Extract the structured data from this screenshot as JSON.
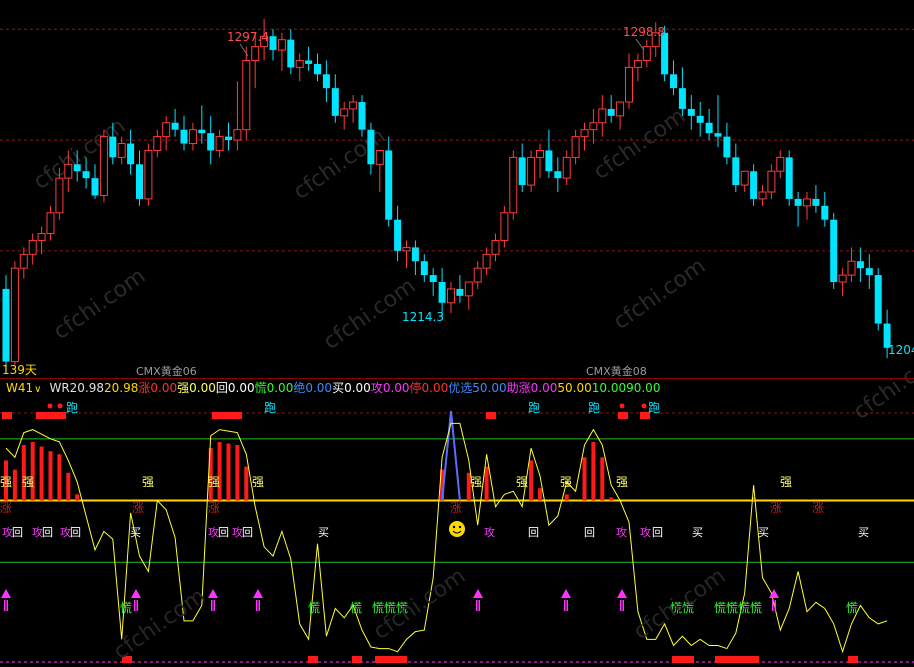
{
  "main_chart": {
    "period_label": "139天",
    "contract_labels": [
      "CMX黄金06",
      "CMX黄金08"
    ],
    "price_annotations": [
      "1297.4",
      "1298.8",
      "1214.3",
      "1204"
    ],
    "watermark": "cfchi.com",
    "colors": {
      "up": "#ff3b3b",
      "down": "#00e5ff",
      "grid": "#8b1a1a",
      "label": "#ff4d4d",
      "low_label": "#00e5ff"
    }
  },
  "indicator": {
    "name": "W41",
    "dropdown_icon": "chevron-down-icon",
    "items": [
      {
        "label": "WR",
        "value": "20.98",
        "label_color": "#e0e0e0",
        "value_color": "#e0e0e0"
      },
      {
        "label": "",
        "value": "20.98",
        "label_color": "#ffd800",
        "value_color": "#ffd800"
      },
      {
        "label": "涨",
        "value": "0.00",
        "label_color": "#ff3030",
        "value_color": "#ff3030"
      },
      {
        "label": "强",
        "value": "0.00",
        "label_color": "#ffff66",
        "value_color": "#ffff66"
      },
      {
        "label": "回",
        "value": "0.00",
        "label_color": "#ffffff",
        "value_color": "#ffffff"
      },
      {
        "label": "慌",
        "value": "0.00",
        "label_color": "#33ff33",
        "value_color": "#33ff33"
      },
      {
        "label": "绝",
        "value": "0.00",
        "label_color": "#3b8bff",
        "value_color": "#3b8bff"
      },
      {
        "label": "买",
        "value": "0.00",
        "label_color": "#ffffff",
        "value_color": "#ffffff"
      },
      {
        "label": "攻",
        "value": "0.00",
        "label_color": "#ff33ff",
        "value_color": "#ff33ff"
      },
      {
        "label": "停",
        "value": "0.00",
        "label_color": "#ff3030",
        "value_color": "#ff3030"
      },
      {
        "label": "优选",
        "value": "50.00",
        "label_color": "#3b8bff",
        "value_color": "#3b8bff"
      },
      {
        "label": "助涨",
        "value": "0.00",
        "label_color": "#ff33ff",
        "value_color": "#ff33ff"
      },
      {
        "label": "",
        "value": "50.00",
        "label_color": "#ffd800",
        "value_color": "#ffd800"
      },
      {
        "label": "",
        "value": "10.00",
        "label_color": "#33ff33",
        "value_color": "#33ff33"
      },
      {
        "label": "",
        "value": "90.00",
        "label_color": "#33ff33",
        "value_color": "#33ff33"
      }
    ],
    "signal_labels": {
      "run": "跑",
      "strong": "强",
      "rise": "涨",
      "buy": "买",
      "panic": "慌",
      "attack": "攻",
      "back": "回"
    },
    "emoji_icon": "smiley-icon"
  },
  "chart_data": [
    {
      "type": "candlestick",
      "title": "",
      "series": [
        {
          "ohlc": [
            [
              1222,
              1226,
              1198,
              1201
            ],
            [
              1201,
              1230,
              1200,
              1228
            ],
            [
              1228,
              1234,
              1225,
              1232
            ],
            [
              1232,
              1238,
              1229,
              1236
            ],
            [
              1236,
              1240,
              1232,
              1238
            ],
            [
              1238,
              1246,
              1236,
              1244
            ],
            [
              1244,
              1257,
              1242,
              1254
            ],
            [
              1254,
              1262,
              1250,
              1258
            ],
            [
              1258,
              1262,
              1253,
              1256
            ],
            [
              1256,
              1260,
              1251,
              1254
            ],
            [
              1254,
              1258,
              1248,
              1249
            ],
            [
              1249,
              1268,
              1247,
              1266
            ],
            [
              1266,
              1270,
              1258,
              1260
            ],
            [
              1260,
              1266,
              1258,
              1264
            ],
            [
              1264,
              1268,
              1255,
              1258
            ],
            [
              1258,
              1262,
              1246,
              1248
            ],
            [
              1248,
              1264,
              1246,
              1262
            ],
            [
              1262,
              1268,
              1260,
              1266
            ],
            [
              1266,
              1272,
              1262,
              1270
            ],
            [
              1270,
              1274,
              1266,
              1268
            ],
            [
              1268,
              1272,
              1262,
              1264
            ],
            [
              1264,
              1270,
              1262,
              1268
            ],
            [
              1268,
              1275,
              1264,
              1267
            ],
            [
              1267,
              1272,
              1258,
              1262
            ],
            [
              1262,
              1268,
              1260,
              1266
            ],
            [
              1266,
              1270,
              1262,
              1265
            ],
            [
              1265,
              1282,
              1262,
              1268
            ],
            [
              1268,
              1292,
              1265,
              1288
            ],
            [
              1288,
              1296,
              1280,
              1292
            ],
            [
              1292,
              1300,
              1288,
              1295
            ],
            [
              1295,
              1297,
              1288,
              1291
            ],
            [
              1291,
              1296,
              1285,
              1294
            ],
            [
              1294,
              1297,
              1284,
              1286
            ],
            [
              1286,
              1290,
              1282,
              1288
            ],
            [
              1288,
              1292,
              1285,
              1287
            ],
            [
              1287,
              1290,
              1282,
              1284
            ],
            [
              1284,
              1288,
              1276,
              1280
            ],
            [
              1280,
              1284,
              1270,
              1272
            ],
            [
              1272,
              1276,
              1268,
              1274
            ],
            [
              1274,
              1278,
              1270,
              1276
            ],
            [
              1276,
              1278,
              1266,
              1268
            ],
            [
              1268,
              1270,
              1255,
              1258
            ],
            [
              1258,
              1262,
              1250,
              1262
            ],
            [
              1262,
              1266,
              1240,
              1242
            ],
            [
              1242,
              1246,
              1230,
              1233
            ],
            [
              1233,
              1236,
              1228,
              1234
            ],
            [
              1234,
              1236,
              1226,
              1230
            ],
            [
              1230,
              1232,
              1224,
              1226
            ],
            [
              1226,
              1228,
              1220,
              1224
            ],
            [
              1224,
              1228,
              1214,
              1218
            ],
            [
              1218,
              1224,
              1215,
              1222
            ],
            [
              1222,
              1226,
              1218,
              1220
            ],
            [
              1220,
              1224,
              1216,
              1224
            ],
            [
              1224,
              1230,
              1222,
              1228
            ],
            [
              1228,
              1234,
              1226,
              1232
            ],
            [
              1232,
              1238,
              1230,
              1236
            ],
            [
              1236,
              1246,
              1234,
              1244
            ],
            [
              1244,
              1262,
              1242,
              1260
            ],
            [
              1260,
              1264,
              1250,
              1252
            ],
            [
              1252,
              1262,
              1250,
              1260
            ],
            [
              1260,
              1264,
              1254,
              1262
            ],
            [
              1262,
              1268,
              1254,
              1256
            ],
            [
              1256,
              1260,
              1250,
              1254
            ],
            [
              1254,
              1262,
              1252,
              1260
            ],
            [
              1260,
              1268,
              1258,
              1266
            ],
            [
              1266,
              1270,
              1262,
              1268
            ],
            [
              1268,
              1274,
              1264,
              1270
            ],
            [
              1270,
              1278,
              1266,
              1274
            ],
            [
              1274,
              1278,
              1270,
              1272
            ],
            [
              1272,
              1276,
              1268,
              1276
            ],
            [
              1276,
              1290,
              1274,
              1286
            ],
            [
              1286,
              1290,
              1282,
              1288
            ],
            [
              1288,
              1294,
              1286,
              1292
            ],
            [
              1292,
              1299,
              1289,
              1296
            ],
            [
              1296,
              1298,
              1282,
              1284
            ],
            [
              1284,
              1288,
              1278,
              1280
            ],
            [
              1280,
              1286,
              1272,
              1274
            ],
            [
              1274,
              1278,
              1268,
              1272
            ],
            [
              1272,
              1276,
              1266,
              1270
            ],
            [
              1270,
              1274,
              1265,
              1267
            ],
            [
              1267,
              1278,
              1263,
              1266
            ],
            [
              1266,
              1270,
              1258,
              1260
            ],
            [
              1260,
              1264,
              1250,
              1252
            ],
            [
              1252,
              1256,
              1250,
              1256
            ],
            [
              1256,
              1258,
              1246,
              1248
            ],
            [
              1248,
              1252,
              1246,
              1250
            ],
            [
              1250,
              1258,
              1248,
              1256
            ],
            [
              1256,
              1262,
              1254,
              1260
            ],
            [
              1260,
              1262,
              1246,
              1248
            ],
            [
              1248,
              1250,
              1240,
              1246
            ],
            [
              1246,
              1250,
              1242,
              1248
            ],
            [
              1248,
              1252,
              1244,
              1246
            ],
            [
              1246,
              1250,
              1240,
              1242
            ],
            [
              1242,
              1244,
              1222,
              1224
            ],
            [
              1224,
              1228,
              1220,
              1226
            ],
            [
              1226,
              1234,
              1224,
              1230
            ],
            [
              1230,
              1234,
              1224,
              1228
            ],
            [
              1228,
              1232,
              1222,
              1226
            ],
            [
              1226,
              1228,
              1210,
              1212
            ],
            [
              1212,
              1216,
              1202,
              1205
            ]
          ]
        }
      ],
      "xlabel": "",
      "ylabel": "",
      "ylim": [
        1198,
        1302
      ]
    },
    {
      "type": "line",
      "title": "",
      "series": [
        {
          "name": "WR",
          "values": [
            84,
            78,
            94,
            96,
            93,
            90,
            88,
            76,
            62,
            40,
            18,
            30,
            25,
            -40,
            42,
            14,
            4,
            50,
            44,
            26,
            -28,
            -28,
            -18,
            92,
            96,
            95,
            94,
            80,
            46,
            20,
            14,
            30,
            12,
            -30,
            -40,
            22,
            -38,
            -20,
            -26,
            -18,
            -34,
            -45,
            -46,
            -46,
            -48,
            -40,
            -35,
            -34,
            0,
            78,
            100,
            100,
            76,
            34,
            80,
            46,
            54,
            56,
            46,
            84,
            66,
            34,
            40,
            62,
            56,
            86,
            96,
            86,
            60,
            50,
            36,
            -22,
            -40,
            -40,
            -30,
            -44,
            -38,
            -44,
            -40,
            -44,
            -44,
            -46,
            -36,
            -10,
            60,
            0,
            -10,
            -34,
            -20,
            4,
            -22,
            -16,
            -20,
            -30,
            -48,
            -30,
            -18,
            -26,
            -30,
            -28
          ]
        }
      ],
      "reference_lines": [
        90,
        50,
        10
      ],
      "ylim": [
        -56,
        110
      ]
    }
  ]
}
